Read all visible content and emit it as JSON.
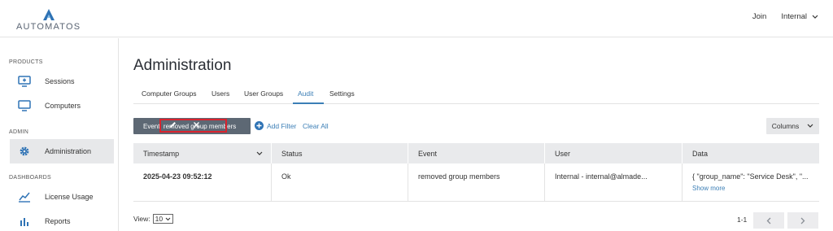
{
  "brand": {
    "wordmark": "AUTOMATOS"
  },
  "header": {
    "join_label": "Join",
    "user_label": "Internal"
  },
  "sidebar": {
    "sections": [
      {
        "title": "PRODUCTS"
      },
      {
        "title": "ADMIN"
      },
      {
        "title": "DASHBOARDS"
      }
    ],
    "items": [
      {
        "label": "Sessions",
        "icon": "sessions-icon"
      },
      {
        "label": "Computers",
        "icon": "monitor-icon"
      },
      {
        "label": "Administration",
        "icon": "gear-icon",
        "active": true
      },
      {
        "label": "License Usage",
        "icon": "license-usage-icon"
      },
      {
        "label": "Reports",
        "icon": "bar-chart-icon"
      }
    ]
  },
  "main": {
    "title": "Administration",
    "tabs": [
      {
        "label": "Computer Groups"
      },
      {
        "label": "Users"
      },
      {
        "label": "User Groups"
      },
      {
        "label": "Audit",
        "active": true
      },
      {
        "label": "Settings"
      }
    ],
    "filter": {
      "chip_label": "Event: removed group members",
      "add_filter_label": "Add Filter",
      "clear_all_label": "Clear All"
    },
    "columns_label": "Columns",
    "table": {
      "headers": [
        "Timestamp",
        "Status",
        "Event",
        "User",
        "Data"
      ],
      "rows": [
        {
          "timestamp": "2025-04-23 09:52:12",
          "status": "Ok",
          "event": "removed group members",
          "user": "Internal - internal@almade...",
          "data": "{ \"group_name\": \"Service Desk\", \"...",
          "show_more": "Show more"
        }
      ]
    },
    "footer": {
      "view_label": "View:",
      "page_size": "10",
      "range": "1-1"
    }
  },
  "colors": {
    "accent": "#3c7fb6",
    "highlight": "#d9232e",
    "chip": "#5d6874"
  }
}
